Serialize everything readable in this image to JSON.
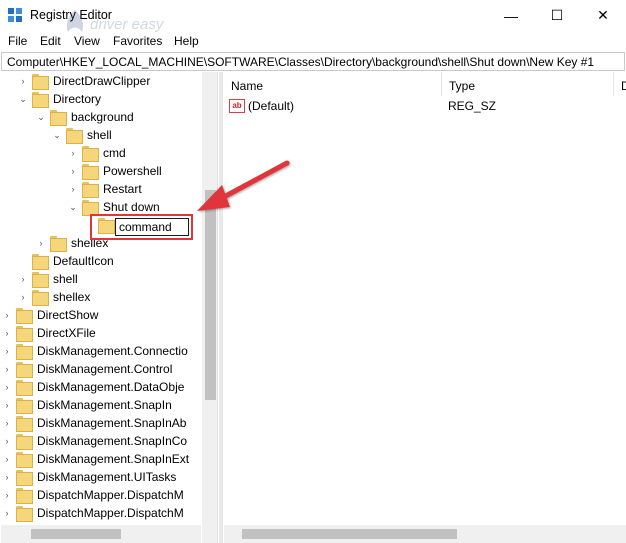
{
  "window": {
    "title": "Registry Editor",
    "watermark_text": "driver easy",
    "min_glyph": "—",
    "max_glyph": "☐",
    "close_glyph": "✕"
  },
  "menu": [
    "File",
    "Edit",
    "View",
    "Favorites",
    "Help"
  ],
  "address": {
    "path": "Computer\\HKEY_LOCAL_MACHINE\\SOFTWARE\\Classes\\Directory\\background\\shell\\Shut down\\New Key #1"
  },
  "tree": {
    "rows": [
      {
        "label": "DirectDrawClipper",
        "expander": "›"
      },
      {
        "label": "Directory",
        "expander": "⌄"
      },
      {
        "label": "background",
        "expander": "⌄"
      },
      {
        "label": "shell",
        "expander": "⌄"
      },
      {
        "label": "cmd",
        "expander": "›"
      },
      {
        "label": "Powershell",
        "expander": "›"
      },
      {
        "label": "Restart",
        "expander": "›"
      },
      {
        "label": "Shut down",
        "expander": "⌄"
      },
      {
        "label": "command",
        "expander": ""
      },
      {
        "label": "shellex",
        "expander": "›"
      },
      {
        "label": "DefaultIcon",
        "expander": ""
      },
      {
        "label": "shell",
        "expander": "›"
      },
      {
        "label": "shellex",
        "expander": "›"
      },
      {
        "label": "DirectShow",
        "expander": "›"
      },
      {
        "label": "DirectXFile",
        "expander": "›"
      },
      {
        "label": "DiskManagement.Connectio",
        "expander": "›"
      },
      {
        "label": "DiskManagement.Control",
        "expander": "›"
      },
      {
        "label": "DiskManagement.DataObje",
        "expander": "›"
      },
      {
        "label": "DiskManagement.SnapIn",
        "expander": "›"
      },
      {
        "label": "DiskManagement.SnapInAb",
        "expander": "›"
      },
      {
        "label": "DiskManagement.SnapInCo",
        "expander": "›"
      },
      {
        "label": "DiskManagement.SnapInExt",
        "expander": "›"
      },
      {
        "label": "DiskManagement.UITasks",
        "expander": "›"
      },
      {
        "label": "DispatchMapper.DispatchM",
        "expander": "›"
      },
      {
        "label": "DispatchMapper.DispatchM",
        "expander": "›"
      }
    ]
  },
  "list": {
    "columns": {
      "name": "Name",
      "type": "Type",
      "data": "D"
    },
    "rows": [
      {
        "icon_label": "ab",
        "name": "(Default)",
        "type": "REG_SZ"
      }
    ]
  },
  "annotation": {
    "color": "#e0353a"
  }
}
